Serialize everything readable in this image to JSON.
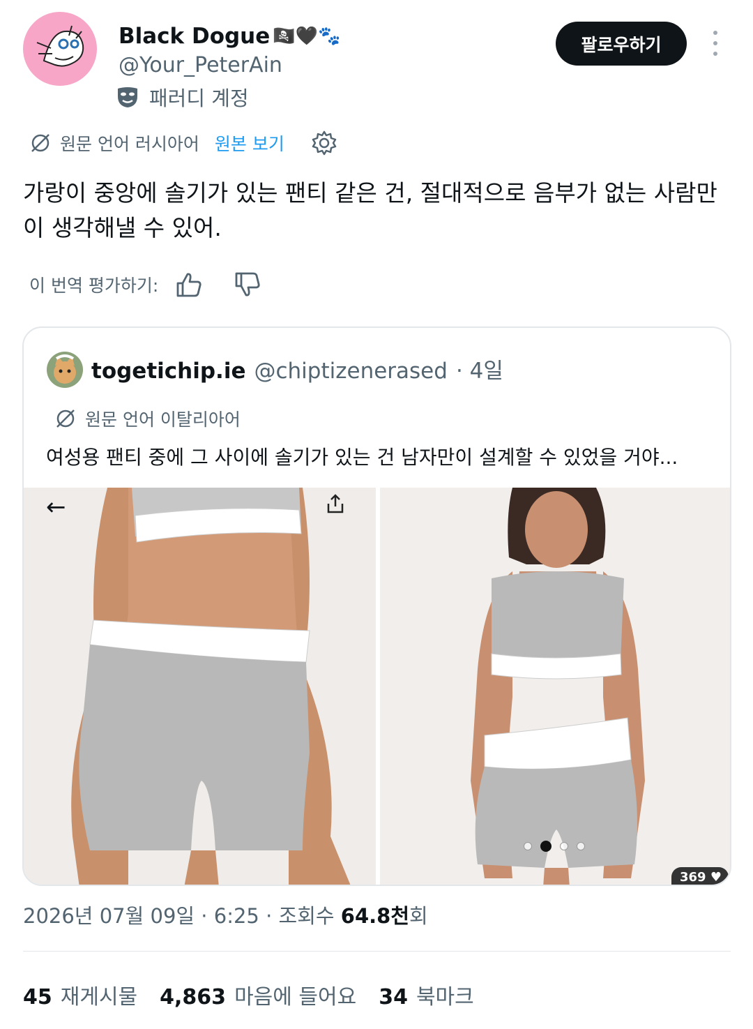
{
  "author": {
    "display_name": "Black Dogue",
    "emojis": "🏴‍☠️🖤🐾",
    "handle": "@Your_PeterAin",
    "parody_label": "패러디 계정"
  },
  "follow_label": "팔로우하기",
  "translation": {
    "source_language": "원문 언어 러시아어",
    "view_original": "원본 보기",
    "rate_prompt": "이 번역 평가하기:"
  },
  "tweet_text": "가랑이 중앙에 솔기가 있는 팬티 같은 건, 절대적으로 음부가 없는 사람만이 생각해낼 수 있어.",
  "quote": {
    "display_name": "togetichip.ie",
    "handle": "@chiptizenerased",
    "age": "· 4일",
    "source_language": "원문 언어 이탈리아어",
    "text": "여성용 팬티 중에 그 사이에 솔기가 있는 건 남자만이 설계할 수 있었을 거야...",
    "carousel": {
      "total": 4,
      "active_index": 1
    },
    "likes_badge": "369"
  },
  "meta": {
    "date": "2026년 07월 09일 · 6:25 · 조회수 ",
    "views": "64.8천",
    "views_suffix": "회"
  },
  "stats": [
    {
      "count": "45",
      "label": "재게시물"
    },
    {
      "count": "4,863",
      "label": "마음에 들어요"
    },
    {
      "count": "34",
      "label": "북마크"
    }
  ],
  "colors": {
    "text_primary": "#0f1419",
    "text_secondary": "#536471",
    "link": "#1d9bf0",
    "border": "#e3e7ea",
    "avatar_bg": "#f7a6c8"
  }
}
